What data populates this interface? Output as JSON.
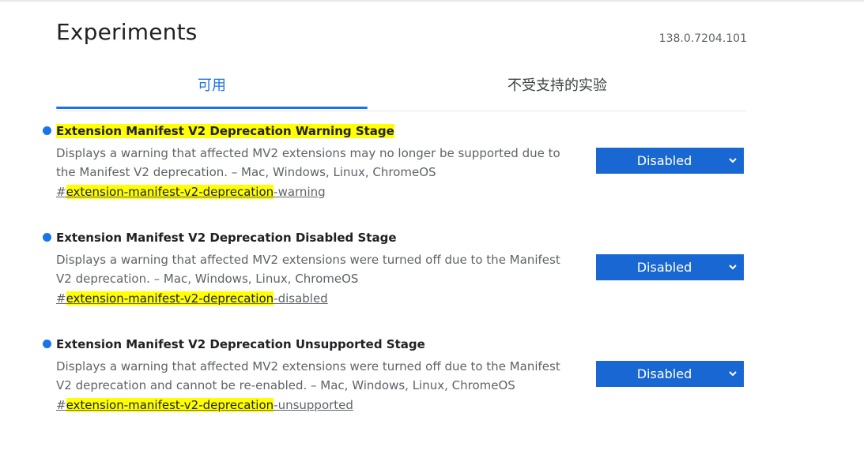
{
  "page": {
    "title": "Experiments",
    "version": "138.0.7204.101"
  },
  "tabs": [
    {
      "label": "可用",
      "active": true
    },
    {
      "label": "不受支持的实验",
      "active": false
    }
  ],
  "experiments": [
    {
      "title": "Extension Manifest V2 Deprecation Warning Stage",
      "description": "Displays a warning that affected MV2 extensions may no longer be supported due to the Manifest V2 deprecation. – Mac, Windows, Linux, ChromeOS",
      "link_hash": "#",
      "link_highlight": "extension-manifest-v2-deprecation",
      "link_suffix": "-warning",
      "selected": "Disabled",
      "title_highlighted": true
    },
    {
      "title": "Extension Manifest V2 Deprecation Disabled Stage",
      "description": "Displays a warning that affected MV2 extensions were turned off due to the Manifest V2 deprecation. – Mac, Windows, Linux, ChromeOS",
      "link_hash": "#",
      "link_highlight": "extension-manifest-v2-deprecation",
      "link_suffix": "-disabled",
      "selected": "Disabled",
      "title_highlighted": false
    },
    {
      "title": "Extension Manifest V2 Deprecation Unsupported Stage",
      "description": "Displays a warning that affected MV2 extensions were turned off due to the Manifest V2 deprecation and cannot be re-enabled. – Mac, Windows, Linux, ChromeOS",
      "link_hash": "#",
      "link_highlight": "extension-manifest-v2-deprecation",
      "link_suffix": "-unsupported",
      "selected": "Disabled",
      "title_highlighted": false
    }
  ],
  "colors": {
    "accent": "#1a73e8",
    "select_bg": "#1967d2",
    "highlight": "#ffff00"
  },
  "icons": {
    "bullet": "dot-icon",
    "select": "chevron-down-icon"
  }
}
